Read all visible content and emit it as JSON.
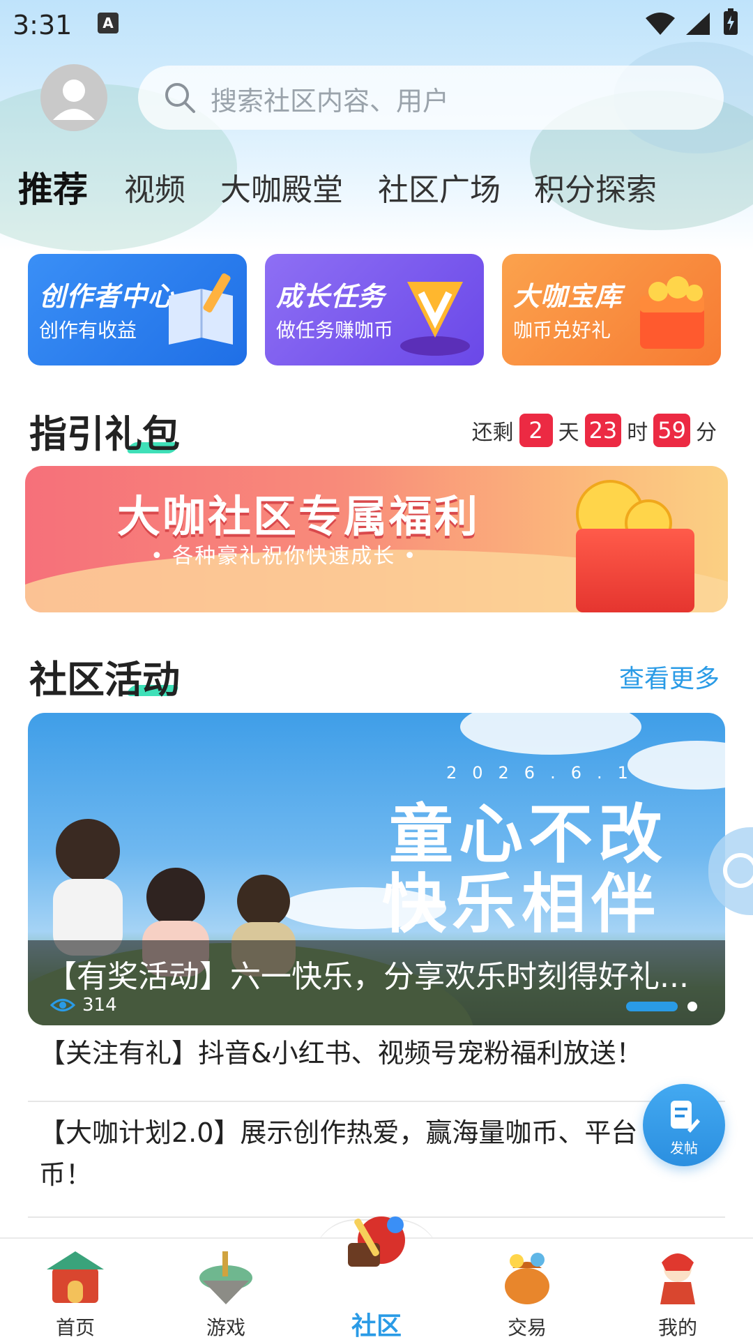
{
  "status_bar": {
    "time": "3:31",
    "notification_icon": "A"
  },
  "search": {
    "placeholder": "搜索社区内容、用户"
  },
  "tabs": [
    {
      "label": "推荐"
    },
    {
      "label": "视频"
    },
    {
      "label": "大咖殿堂"
    },
    {
      "label": "社区广场"
    },
    {
      "label": "积分探索"
    }
  ],
  "feature_cards": [
    {
      "title": "创作者中心",
      "subtitle": "创作有收益",
      "color": "#2f7ff0"
    },
    {
      "title": "成长任务",
      "subtitle": "做任务赚咖币",
      "color": "#7e5cf0"
    },
    {
      "title": "大咖宝库",
      "subtitle": "咖币兑好礼",
      "color": "#f7893e"
    }
  ],
  "gift_section": {
    "title": "指引礼包",
    "countdown": {
      "prefix": "还剩",
      "days": "2",
      "days_unit": "天",
      "hours": "23",
      "hours_unit": "时",
      "minutes": "59",
      "minutes_unit": "分"
    },
    "banner": {
      "title": "大咖社区专属福利",
      "subtitle": "• 各种豪礼祝你快速成长 •"
    }
  },
  "activity_section": {
    "title": "社区活动",
    "more_label": "查看更多",
    "carousel": {
      "date": "2026.6.1",
      "headline_line1": "童心不改",
      "headline_line2": "快乐相伴",
      "caption": "【有奖活动】六一快乐，分享欢乐时刻得好礼...",
      "views": "314",
      "slide_index": 1,
      "slide_count": 2
    },
    "posts": [
      {
        "text": "【关注有礼】抖音&小红书、视频号宠粉福利放送！"
      },
      {
        "text": "【大咖计划2.0】展示创作热爱，赢海量咖币、平台币！"
      }
    ]
  },
  "fab": {
    "label": "发帖"
  },
  "bottom_nav": [
    {
      "label": "首页",
      "icon": "home-gate-icon"
    },
    {
      "label": "游戏",
      "icon": "game-island-icon"
    },
    {
      "label": "社区",
      "icon": "community-drum-icon"
    },
    {
      "label": "交易",
      "icon": "trade-bag-icon"
    },
    {
      "label": "我的",
      "icon": "profile-character-icon"
    }
  ],
  "colors": {
    "accent": "#2a9be6",
    "countdown_red": "#ec2a43"
  }
}
